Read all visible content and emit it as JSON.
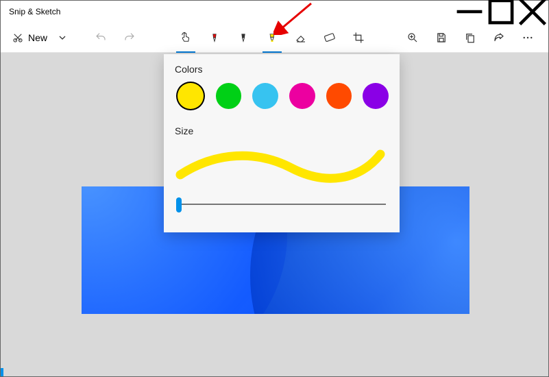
{
  "title": "Snip & Sketch",
  "toolbar": {
    "new_label": "New"
  },
  "popup": {
    "colors_label": "Colors",
    "size_label": "Size",
    "colors": [
      {
        "name": "yellow",
        "hex": "#ffe600",
        "selected": true
      },
      {
        "name": "green",
        "hex": "#00d016",
        "selected": false
      },
      {
        "name": "sky-blue",
        "hex": "#37c3f0",
        "selected": false
      },
      {
        "name": "magenta",
        "hex": "#ec00a0",
        "selected": false
      },
      {
        "name": "orange",
        "hex": "#ff4a00",
        "selected": false
      },
      {
        "name": "purple",
        "hex": "#8a00e6",
        "selected": false
      }
    ],
    "stroke_color": "#ffe600",
    "slider_value": 0
  }
}
